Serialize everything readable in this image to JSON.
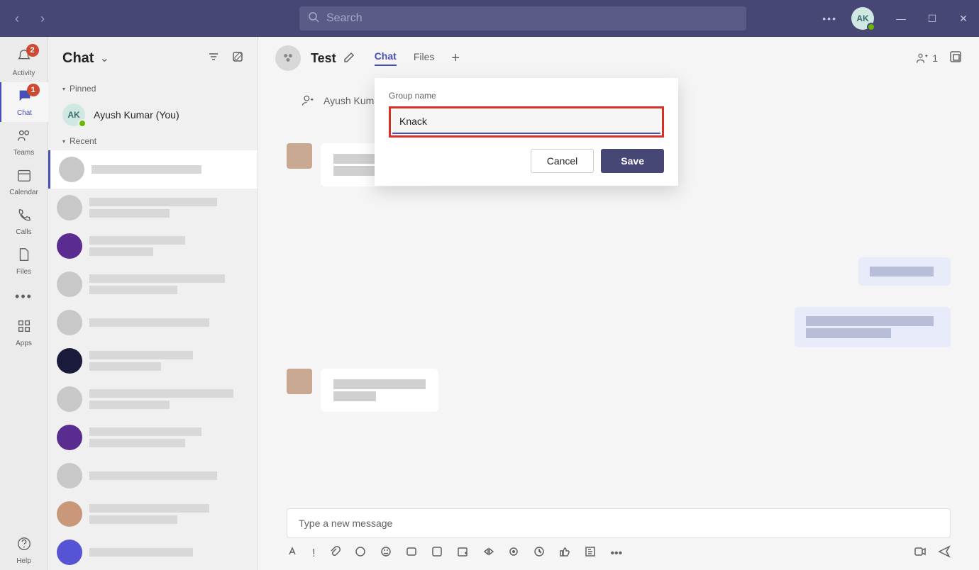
{
  "titlebar": {
    "search_placeholder": "Search",
    "avatar_initials": "AK",
    "more_dots": "•••"
  },
  "rail": {
    "activity": {
      "label": "Activity",
      "badge": "2"
    },
    "chat": {
      "label": "Chat",
      "badge": "1"
    },
    "teams": {
      "label": "Teams"
    },
    "calendar": {
      "label": "Calendar"
    },
    "calls": {
      "label": "Calls"
    },
    "files": {
      "label": "Files"
    },
    "apps": {
      "label": "Apps"
    },
    "help": {
      "label": "Help"
    }
  },
  "chatlist": {
    "title": "Chat",
    "pinned_label": "Pinned",
    "pinned_user": "Ayush Kumar (You)",
    "pinned_initials": "AK",
    "recent_label": "Recent"
  },
  "content_header": {
    "title": "Test",
    "tab_chat": "Chat",
    "tab_files": "Files",
    "participant_count": "1"
  },
  "conversation": {
    "added_text": "Ayush Kumar added"
  },
  "composer": {
    "placeholder": "Type a new message"
  },
  "dialog": {
    "label": "Group name",
    "input_value": "Knack",
    "cancel": "Cancel",
    "save": "Save"
  }
}
